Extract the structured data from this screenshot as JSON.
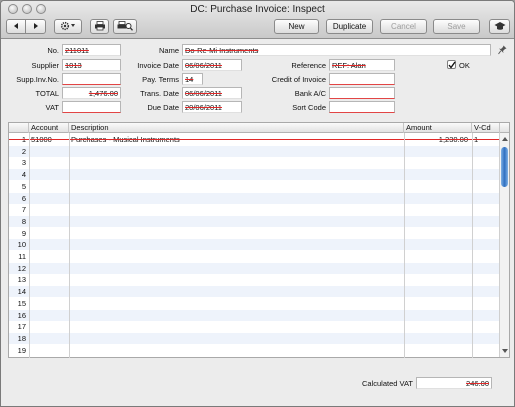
{
  "window": {
    "title": "DC: Purchase Invoice: Inspect"
  },
  "toolbar": {
    "new_label": "New",
    "duplicate_label": "Duplicate",
    "cancel_label": "Cancel",
    "save_label": "Save"
  },
  "header": {
    "no_label": "No.",
    "no_value": "211011",
    "name_label": "Name",
    "name_value": "Do-Re-Mi Instruments",
    "supplier_label": "Supplier",
    "supplier_value": "1013",
    "invoice_date_label": "Invoice Date",
    "invoice_date_value": "06/06/2011",
    "reference_label": "Reference",
    "reference_value": "REF: Alan",
    "ok_label": "OK",
    "ok_checked": true,
    "supp_inv_label": "Supp.Inv.No.",
    "supp_inv_value": "",
    "pay_terms_label": "Pay. Terms",
    "pay_terms_value": "14",
    "credit_label": "Credit of Invoice",
    "credit_value": "",
    "total_label": "TOTAL",
    "total_value": "1,476.00",
    "trans_date_label": "Trans. Date",
    "trans_date_value": "06/06/2011",
    "bank_label": "Bank A/C",
    "bank_value": "",
    "vat_label": "VAT",
    "vat_value": "",
    "due_date_label": "Due Date",
    "due_date_value": "20/06/2011",
    "sort_code_label": "Sort Code",
    "sort_code_value": ""
  },
  "grid": {
    "columns": [
      "Account",
      "Description",
      "Amount",
      "V-Cd"
    ],
    "rows": [
      {
        "n": "1",
        "account": "51000",
        "description": "Purchases - Musical Instruments",
        "amount": "1,230.00",
        "vcd": "1"
      },
      {
        "n": "2"
      },
      {
        "n": "3"
      },
      {
        "n": "4"
      },
      {
        "n": "5"
      },
      {
        "n": "6"
      },
      {
        "n": "7"
      },
      {
        "n": "8"
      },
      {
        "n": "9"
      },
      {
        "n": "10"
      },
      {
        "n": "11"
      },
      {
        "n": "12"
      },
      {
        "n": "13"
      },
      {
        "n": "14"
      },
      {
        "n": "15"
      },
      {
        "n": "16"
      },
      {
        "n": "17"
      },
      {
        "n": "18"
      },
      {
        "n": "19"
      }
    ]
  },
  "footer": {
    "calc_vat_label": "Calculated VAT",
    "calc_vat_value": "246.00"
  },
  "colors": {
    "accent": "#2f6fc0",
    "strike": "#e02828",
    "row_alt": "#eef3fb"
  }
}
